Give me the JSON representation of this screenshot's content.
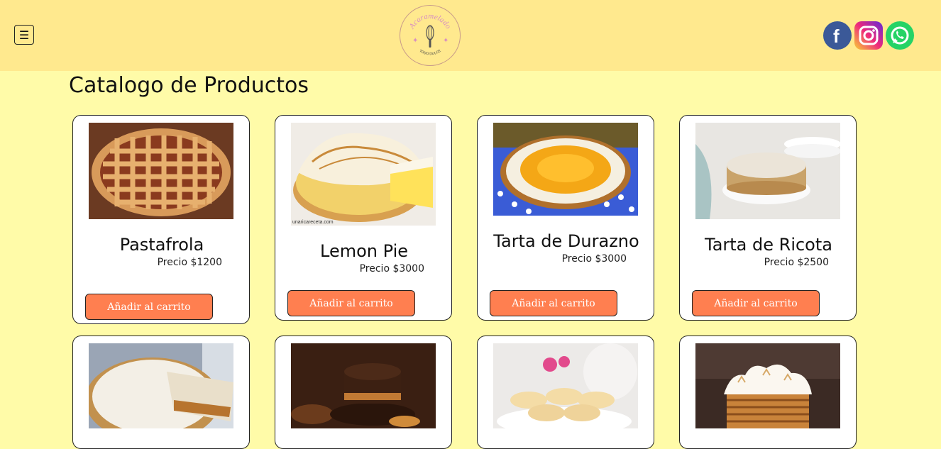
{
  "header": {
    "menu_icon": "☰",
    "logo_title": "Acaramelado",
    "logo_subtitle": "TODO DULCE",
    "socials": [
      {
        "name": "facebook",
        "color": "#3b5998"
      },
      {
        "name": "instagram",
        "color": "#ee2a7b"
      },
      {
        "name": "whatsapp",
        "color": "#25d366"
      }
    ]
  },
  "page_title": "Catalogo de Productos",
  "products": [
    {
      "name": "Pastafrola",
      "price": "Precio $1200",
      "button": "Añadir al carrito"
    },
    {
      "name": "Lemon Pie",
      "price": "Precio $3000",
      "button": "Añadir al carrito",
      "watermark": "unaricareceta.com"
    },
    {
      "name": "Tarta de Durazno",
      "price": "Precio $3000",
      "button": "Añadir al carrito"
    },
    {
      "name": "Tarta de Ricota",
      "price": "Precio $2500",
      "button": "Añadir al carrito"
    },
    {
      "name": "",
      "price": "",
      "button": ""
    },
    {
      "name": "",
      "price": "",
      "button": ""
    },
    {
      "name": "",
      "price": "",
      "button": ""
    },
    {
      "name": "",
      "price": "",
      "button": ""
    }
  ],
  "colors": {
    "background": "#fffba8",
    "header": "#ffe98e",
    "accent": "#ff7f50"
  }
}
